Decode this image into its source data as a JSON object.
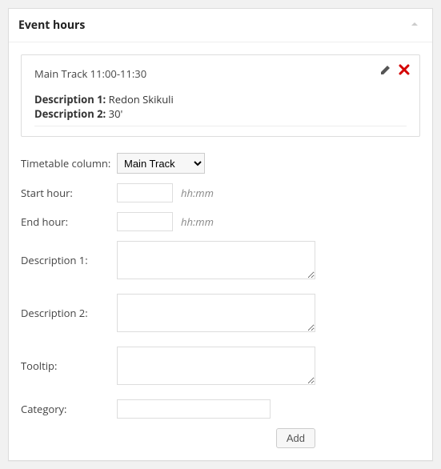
{
  "metabox": {
    "title": "Event hours"
  },
  "entry": {
    "title": "Main Track 11:00-11:30",
    "desc1_label": "Description 1:",
    "desc1_value": "Redon Skikuli",
    "desc2_label": "Description 2:",
    "desc2_value": "30'"
  },
  "form": {
    "timetable_label": "Timetable column:",
    "timetable_value": "Main Track",
    "timetable_options": [
      "Main Track"
    ],
    "start_label": "Start hour:",
    "start_value": "",
    "start_hint": "hh:mm",
    "end_label": "End hour:",
    "end_value": "",
    "end_hint": "hh:mm",
    "desc1_label": "Description 1:",
    "desc1_value": "",
    "desc2_label": "Description 2:",
    "desc2_value": "",
    "tooltip_label": "Tooltip:",
    "tooltip_value": "",
    "category_label": "Category:",
    "category_value": "",
    "add_button": "Add"
  },
  "icons": {
    "edit": "edit-icon",
    "delete": "delete-icon",
    "toggle": "collapse-toggle"
  }
}
